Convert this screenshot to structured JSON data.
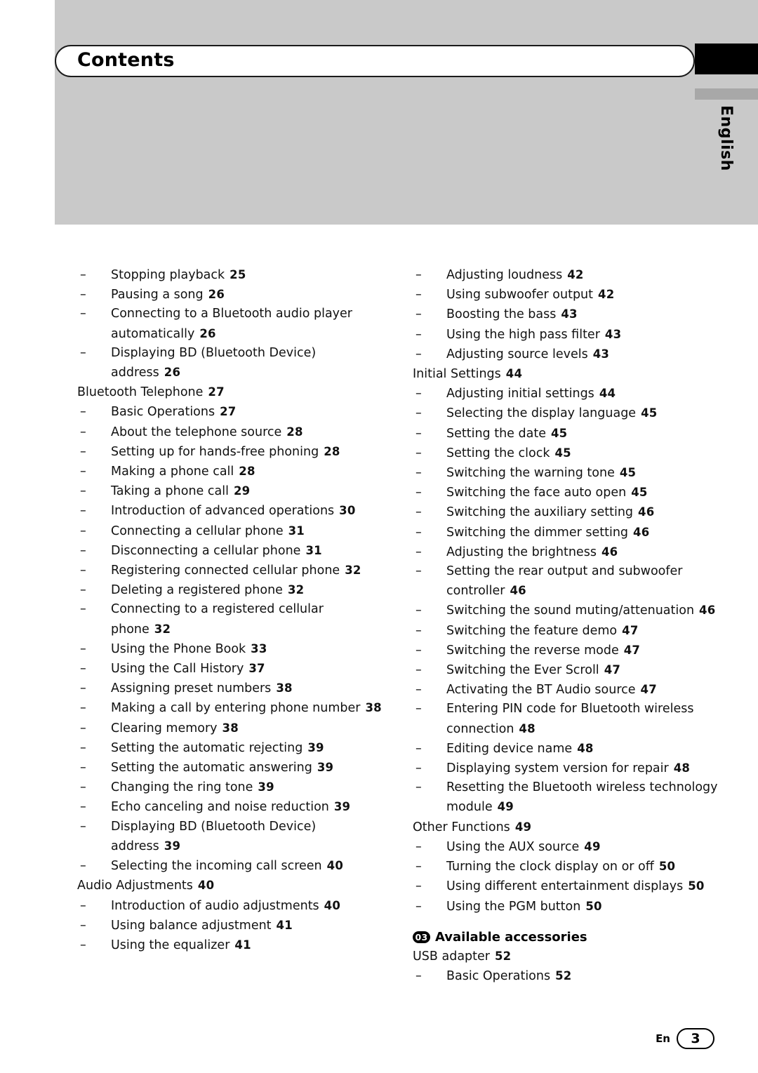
{
  "header": {
    "title": "Contents",
    "language_tab": "English"
  },
  "footer": {
    "locale": "En",
    "page_number": "3"
  },
  "left_column": [
    {
      "level": 2,
      "text": "Stopping playback",
      "page": "25"
    },
    {
      "level": 2,
      "text": "Pausing a song",
      "page": "26"
    },
    {
      "level": 2,
      "text": "Connecting to a Bluetooth audio player automatically",
      "page": "26"
    },
    {
      "level": 2,
      "text": "Displaying BD (Bluetooth Device) address",
      "page": "26"
    },
    {
      "level": 1,
      "text": "Bluetooth Telephone",
      "page": "27"
    },
    {
      "level": 2,
      "text": "Basic Operations",
      "page": "27"
    },
    {
      "level": 2,
      "text": "About the telephone source",
      "page": "28"
    },
    {
      "level": 2,
      "text": "Setting up for hands-free phoning",
      "page": "28"
    },
    {
      "level": 2,
      "text": "Making a phone call",
      "page": "28"
    },
    {
      "level": 2,
      "text": "Taking a phone call",
      "page": "29"
    },
    {
      "level": 2,
      "text": "Introduction of advanced operations",
      "page": "30"
    },
    {
      "level": 2,
      "text": "Connecting a cellular phone",
      "page": "31"
    },
    {
      "level": 2,
      "text": "Disconnecting a cellular phone",
      "page": "31"
    },
    {
      "level": 2,
      "text": "Registering connected cellular phone",
      "page": "32"
    },
    {
      "level": 2,
      "text": "Deleting a registered phone",
      "page": "32"
    },
    {
      "level": 2,
      "text": "Connecting to a registered cellular phone",
      "page": "32"
    },
    {
      "level": 2,
      "text": "Using the Phone Book",
      "page": "33"
    },
    {
      "level": 2,
      "text": "Using the Call History",
      "page": "37"
    },
    {
      "level": 2,
      "text": "Assigning preset numbers",
      "page": "38"
    },
    {
      "level": 2,
      "text": "Making a call by entering phone number",
      "page": "38"
    },
    {
      "level": 2,
      "text": "Clearing memory",
      "page": "38"
    },
    {
      "level": 2,
      "text": "Setting the automatic rejecting",
      "page": "39"
    },
    {
      "level": 2,
      "text": "Setting the automatic answering",
      "page": "39"
    },
    {
      "level": 2,
      "text": "Changing the ring tone",
      "page": "39"
    },
    {
      "level": 2,
      "text": "Echo canceling and noise reduction",
      "page": "39"
    },
    {
      "level": 2,
      "text": "Displaying BD (Bluetooth Device) address",
      "page": "39"
    },
    {
      "level": 2,
      "text": "Selecting the incoming call screen",
      "page": "40"
    },
    {
      "level": 1,
      "text": "Audio Adjustments",
      "page": "40"
    },
    {
      "level": 2,
      "text": "Introduction of audio adjustments",
      "page": "40"
    },
    {
      "level": 2,
      "text": "Using balance adjustment",
      "page": "41"
    },
    {
      "level": 2,
      "text": "Using the equalizer",
      "page": "41"
    }
  ],
  "right_column": [
    {
      "level": 2,
      "text": "Adjusting loudness",
      "page": "42"
    },
    {
      "level": 2,
      "text": "Using subwoofer output",
      "page": "42"
    },
    {
      "level": 2,
      "text": "Boosting the bass",
      "page": "43"
    },
    {
      "level": 2,
      "text": "Using the high pass filter",
      "page": "43"
    },
    {
      "level": 2,
      "text": "Adjusting source levels",
      "page": "43"
    },
    {
      "level": 1,
      "text": "Initial Settings",
      "page": "44"
    },
    {
      "level": 2,
      "text": "Adjusting initial settings",
      "page": "44"
    },
    {
      "level": 2,
      "text": "Selecting the display language",
      "page": "45"
    },
    {
      "level": 2,
      "text": "Setting the date",
      "page": "45"
    },
    {
      "level": 2,
      "text": "Setting the clock",
      "page": "45"
    },
    {
      "level": 2,
      "text": "Switching the warning tone",
      "page": "45"
    },
    {
      "level": 2,
      "text": "Switching the face auto open",
      "page": "45"
    },
    {
      "level": 2,
      "text": "Switching the auxiliary setting",
      "page": "46"
    },
    {
      "level": 2,
      "text": "Switching the dimmer setting",
      "page": "46"
    },
    {
      "level": 2,
      "text": "Adjusting the brightness",
      "page": "46"
    },
    {
      "level": 2,
      "text": "Setting the rear output and subwoofer controller",
      "page": "46"
    },
    {
      "level": 2,
      "text": "Switching the sound muting/attenuation",
      "page": "46"
    },
    {
      "level": 2,
      "text": "Switching the feature demo",
      "page": "47"
    },
    {
      "level": 2,
      "text": "Switching the reverse mode",
      "page": "47"
    },
    {
      "level": 2,
      "text": "Switching the Ever Scroll",
      "page": "47"
    },
    {
      "level": 2,
      "text": "Activating the BT Audio source",
      "page": "47"
    },
    {
      "level": 2,
      "text": "Entering PIN code for Bluetooth wireless connection",
      "page": "48"
    },
    {
      "level": 2,
      "text": "Editing device name",
      "page": "48"
    },
    {
      "level": 2,
      "text": "Displaying system version for repair",
      "page": "48"
    },
    {
      "level": 2,
      "text": "Resetting the Bluetooth wireless technology module",
      "page": "49"
    },
    {
      "level": 1,
      "text": "Other Functions",
      "page": "49"
    },
    {
      "level": 2,
      "text": "Using the AUX source",
      "page": "49"
    },
    {
      "level": 2,
      "text": "Turning the clock display on or off",
      "page": "50"
    },
    {
      "level": 2,
      "text": "Using different entertainment displays",
      "page": "50"
    },
    {
      "level": 2,
      "text": "Using the PGM button",
      "page": "50"
    }
  ],
  "chapter": {
    "number": "03",
    "title": "Available accessories",
    "entries": [
      {
        "level": 1,
        "text": "USB adapter",
        "page": "52"
      },
      {
        "level": 2,
        "text": "Basic Operations",
        "page": "52"
      }
    ]
  }
}
